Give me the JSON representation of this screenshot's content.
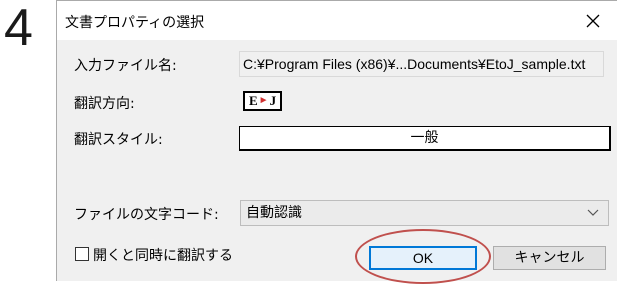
{
  "step": {
    "number": "4"
  },
  "dialog": {
    "title": "文書プロパティの選択",
    "fields": {
      "input_filename_label": "入力ファイル名:",
      "input_filename_value": "C:¥Program Files (x86)¥...Documents¥EtoJ_sample.txt",
      "direction_label": "翻訳方向:",
      "direction_badge_left": "E",
      "direction_badge_arrow": "►",
      "direction_badge_right": "J",
      "style_label": "翻訳スタイル:",
      "style_value": "一般",
      "encoding_label": "ファイルの文字コード:",
      "encoding_value": "自動認識"
    },
    "checkbox": {
      "label": "開くと同時に翻訳する",
      "checked": false
    },
    "buttons": {
      "ok": "OK",
      "cancel": "キャンセル"
    },
    "icons": {
      "close": "close-icon",
      "dropdown": "chevron-down-icon"
    },
    "colors": {
      "highlight_ring": "#c0504d",
      "ok_border": "#0078d7"
    }
  }
}
